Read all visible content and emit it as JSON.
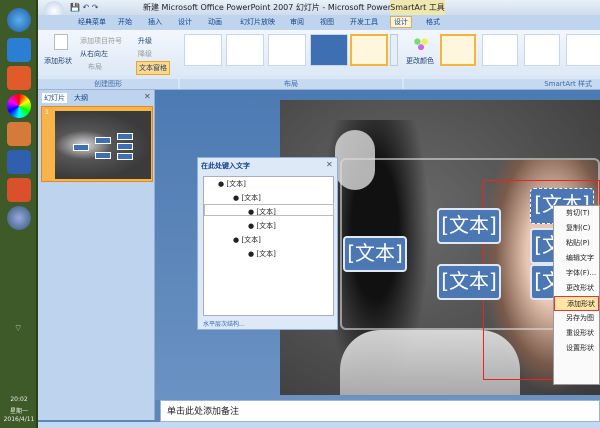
{
  "taskbar": {
    "time": "20:02",
    "weekday": "星期一",
    "date": "2016/4/11"
  },
  "title": {
    "text": "新建 Microsoft Office PowerPoint 2007 幻灯片 - Microsoft PowerPoi...",
    "context_tool": "SmartArt 工具"
  },
  "tabs": [
    "经典菜单",
    "开始",
    "插入",
    "设计",
    "动画",
    "幻灯片放映",
    "审阅",
    "视图",
    "开发工具",
    "设计",
    "格式"
  ],
  "ribbon": {
    "add_shape": "添加形状",
    "add_bullet": "添加项目符号",
    "rtl": "从右向左",
    "layout_btn": "布局",
    "promote": "升级",
    "demote": "降级",
    "text_pane": "文本窗格",
    "group_create": "创建图形",
    "group_layout": "布局",
    "change_colors": "更改颜色",
    "group_styles": "SmartArt 样式"
  },
  "leftpanel": {
    "tab_slides": "幻灯片",
    "tab_outline": "大纲",
    "slide_number": "1"
  },
  "textpane": {
    "title": "在此处键入文字",
    "items": [
      {
        "level": 1,
        "text": "[文本]"
      },
      {
        "level": 2,
        "text": "[文本]"
      },
      {
        "level": 3,
        "text": "[文本]"
      },
      {
        "level": 3,
        "text": "[文本]"
      },
      {
        "level": 2,
        "text": "[文本]"
      },
      {
        "level": 3,
        "text": "[文本]"
      }
    ],
    "footer": "水平层次结构..."
  },
  "smartart": {
    "box_text": "[文本]"
  },
  "context_menu": [
    "剪切(T)",
    "复制(C)",
    "粘贴(P)",
    "编辑文字",
    "字体(F)...",
    "更改形状",
    "添加形状",
    "另存为图",
    "重设形状",
    "设置形状"
  ],
  "notes": "单击此处添加备注"
}
